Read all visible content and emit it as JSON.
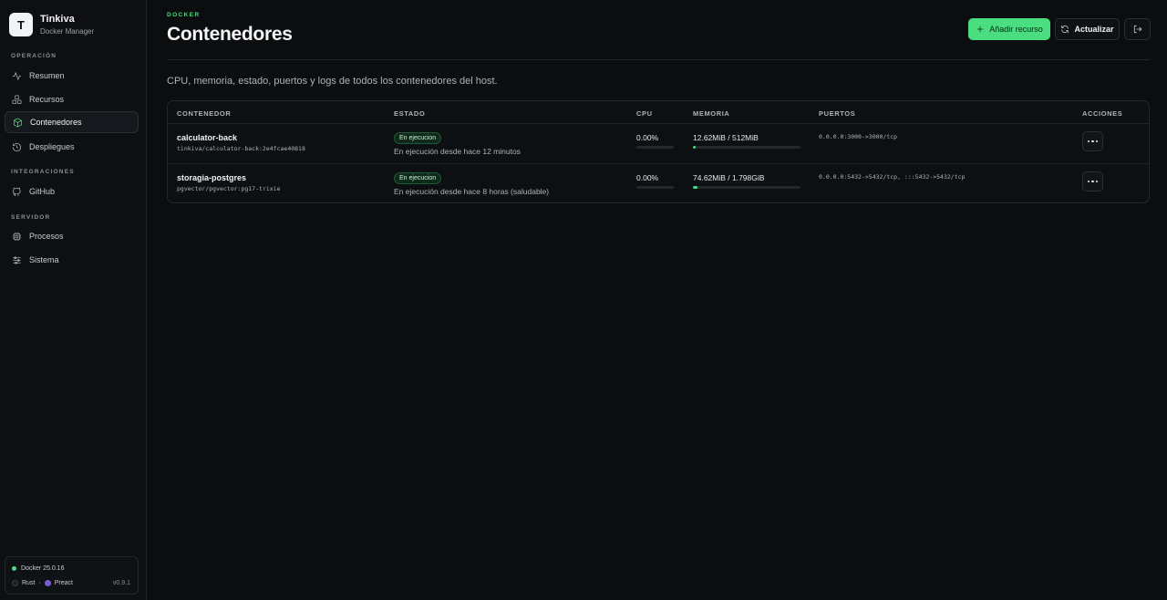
{
  "brand": {
    "initial": "T",
    "name": "Tinkiva",
    "subtitle": "Docker Manager"
  },
  "sidebar": {
    "sections": [
      {
        "label": "OPERACIÓN",
        "items": [
          {
            "label": "Resumen",
            "icon": "activity-icon"
          },
          {
            "label": "Recursos",
            "icon": "boxes-icon"
          },
          {
            "label": "Contenedores",
            "icon": "container-icon",
            "active": true
          },
          {
            "label": "Despliegues",
            "icon": "history-icon"
          }
        ]
      },
      {
        "label": "INTEGRACIONES",
        "items": [
          {
            "label": "GitHub",
            "icon": "github-icon"
          }
        ]
      },
      {
        "label": "SERVIDOR",
        "items": [
          {
            "label": "Procesos",
            "icon": "cpu-icon"
          },
          {
            "label": "Sistema",
            "icon": "sliders-icon"
          }
        ]
      }
    ],
    "footer": {
      "docker_version": "Docker 25.0.16",
      "tech_rust": "Rust",
      "tech_sep": "·",
      "tech_preact": "Preact",
      "app_version": "v0.9.1"
    }
  },
  "header": {
    "eyebrow": "DOCKER",
    "title": "Contenedores",
    "add_button": "Añadir recurso",
    "refresh_button": "Actualizar",
    "subtitle": "CPU, memoria, estado, puertos y logs de todos los contenedores del host."
  },
  "table": {
    "columns": [
      "CONTENEDOR",
      "ESTADO",
      "CPU",
      "MEMORIA",
      "PUERTOS",
      "ACCIONES"
    ],
    "rows": [
      {
        "name": "calculator-back",
        "image": "tinkiva/calculator-back:2e4fcae40818",
        "badge": "En ejecucion",
        "status": "En ejecución desde hace 12 minutos",
        "cpu": "0.00%",
        "cpu_fraction": 0.0,
        "memory": "12.62MiB / 512MiB",
        "memory_fraction": 0.025,
        "ports": "0.0.0.0:3000->3000/tcp"
      },
      {
        "name": "storagia-postgres",
        "image": "pgvector/pgvector:pg17-trixie",
        "badge": "En ejecucion",
        "status": "En ejecución desde hace 8 horas (saludable)",
        "cpu": "0.00%",
        "cpu_fraction": 0.0,
        "memory": "74.62MiB / 1.798GiB",
        "memory_fraction": 0.04,
        "ports": "0.0.0.0:5432->5432/tcp, :::5432->5432/tcp"
      }
    ]
  },
  "colors": {
    "accent": "#4ade80",
    "background": "#0b0d0f"
  }
}
